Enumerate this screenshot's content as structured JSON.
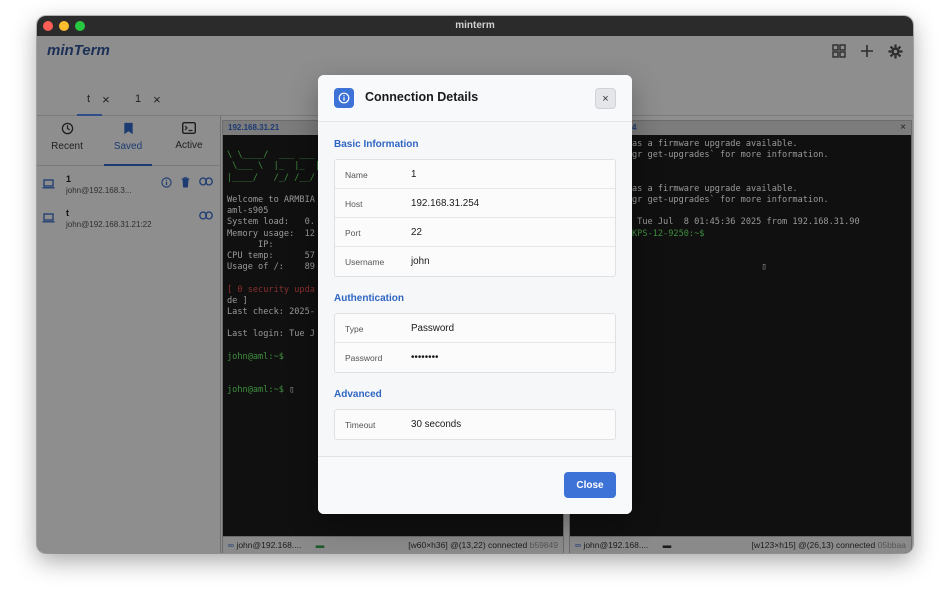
{
  "window": {
    "title": "minterm"
  },
  "app": {
    "brand": "minTerm"
  },
  "header_icons": [
    "grid-icon",
    "plus-icon",
    "gear-icon"
  ],
  "tabs": [
    {
      "label": "t",
      "close": "×"
    },
    {
      "label": "1",
      "close": "×"
    }
  ],
  "sidebar": {
    "tabs": [
      {
        "label": "Recent",
        "icon": "history-icon"
      },
      {
        "label": "Saved",
        "icon": "bookmark-icon"
      },
      {
        "label": "Active",
        "icon": "terminal-icon"
      }
    ],
    "connections": [
      {
        "name": "1",
        "address": "john@192.168.3..."
      },
      {
        "name": "t",
        "address": "john@192.168.31.21:22"
      }
    ]
  },
  "left_pane": {
    "header": "192.168.31.21",
    "lines": [
      "Welcome to ARMBIA",
      "aml-s905",
      "System load:   0.",
      "Memory usage:  12",
      "      IP:",
      "CPU temp:      57",
      "Usage of /:    89",
      "",
      "[ 0 security upda",
      "de ]",
      "Last check: 2025-",
      "",
      "Last login: Tue J",
      "",
      "john@aml:~$",
      "",
      "",
      "john@aml:~$"
    ],
    "status_left": "john@192.168....",
    "status_right": "[w60×h36] @(13,22) connected",
    "status_id": "b59849"
  },
  "right_pane": {
    "header": "4",
    "lines": [
      "as a firmware upgrade available.",
      "gr get-upgrades` for more information.",
      "",
      "",
      "as a firmware upgrade available.",
      "gr get-upgrades` for more information.",
      "",
      " Tue Jul  8 01:45:36 2025 from 192.168.31.90",
      "KPS-12-9250:~$"
    ],
    "status_left": "john@192.168....",
    "status_right": "[w123×h15] @(26,13) connected",
    "status_id": "05bbaa"
  },
  "modal": {
    "title": "Connection Details",
    "sections": {
      "basic": {
        "title": "Basic Information",
        "rows": [
          {
            "key": "Name",
            "value": "1"
          },
          {
            "key": "Host",
            "value": "192.168.31.254"
          },
          {
            "key": "Port",
            "value": "22"
          },
          {
            "key": "Username",
            "value": "john"
          }
        ]
      },
      "auth": {
        "title": "Authentication",
        "rows": [
          {
            "key": "Type",
            "value": "Password"
          },
          {
            "key": "Password",
            "value": "••••••••"
          }
        ]
      },
      "advanced": {
        "title": "Advanced",
        "rows": [
          {
            "key": "Timeout",
            "value": "30 seconds"
          }
        ]
      }
    },
    "close_button": "Close",
    "close_icon": "×"
  }
}
